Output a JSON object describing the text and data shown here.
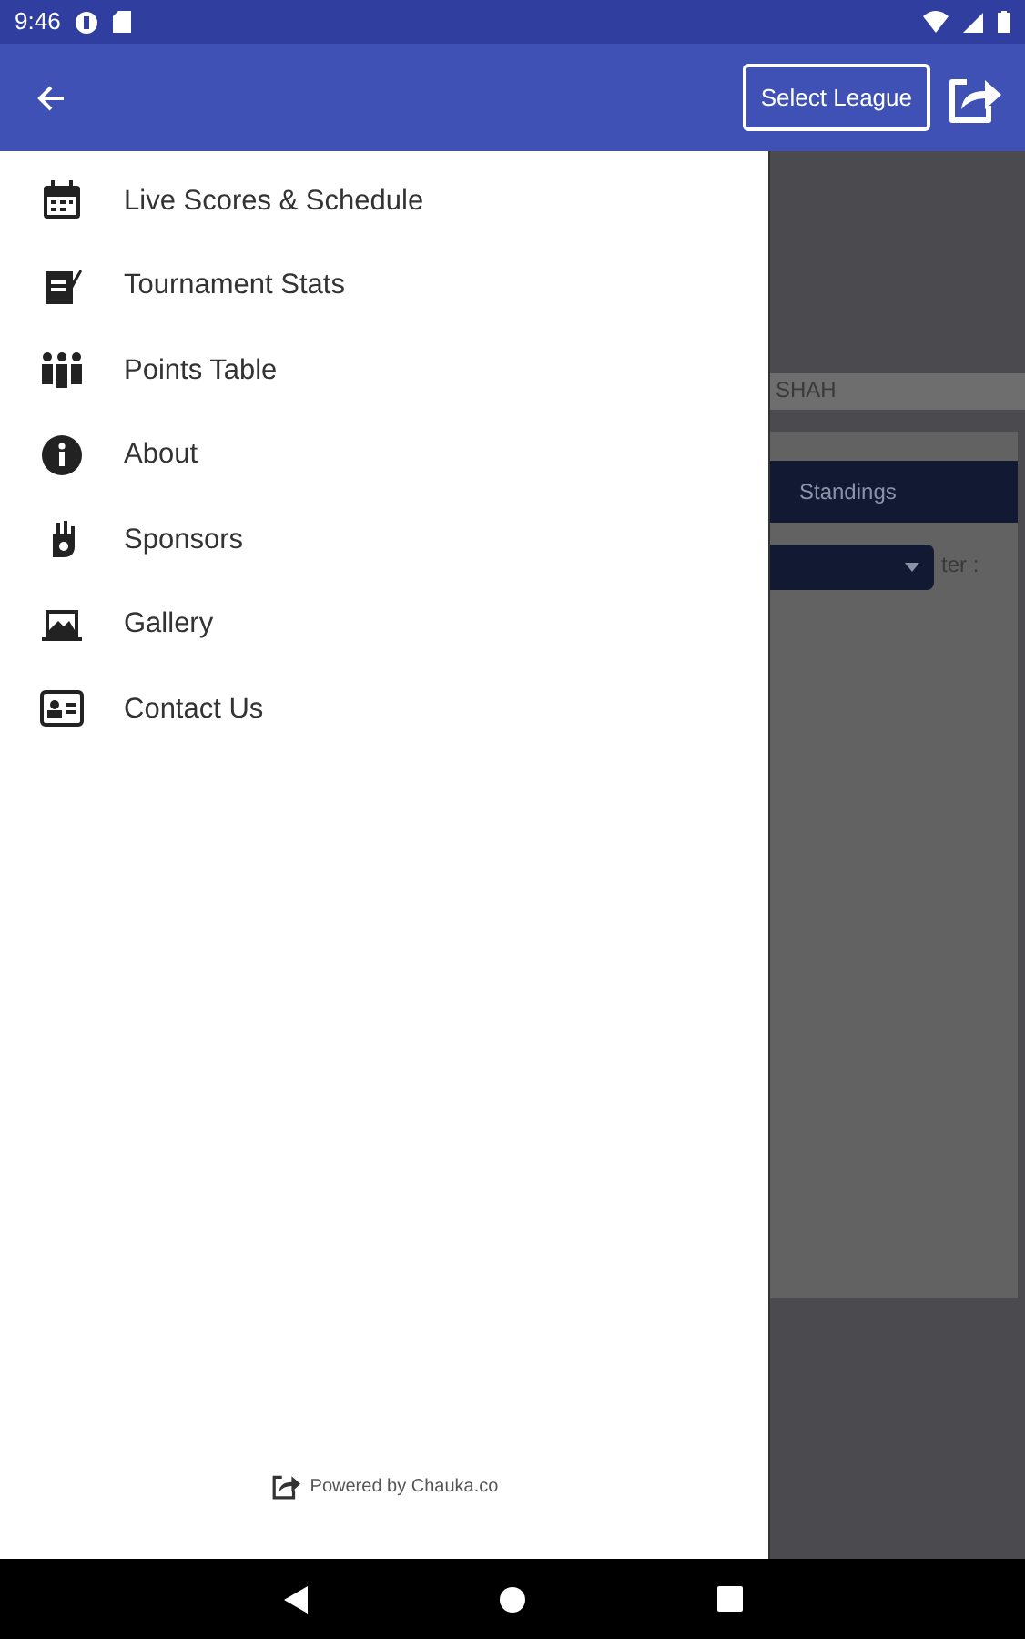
{
  "status_bar": {
    "time": "9:46"
  },
  "app_bar": {
    "select_button": "Select League"
  },
  "drawer": {
    "items": [
      {
        "label": "Live Scores & Schedule"
      },
      {
        "label": "Tournament Stats"
      },
      {
        "label": "Points Table"
      },
      {
        "label": "About"
      },
      {
        "label": "Sponsors"
      },
      {
        "label": "Gallery"
      },
      {
        "label": "Contact Us"
      }
    ],
    "footer": "Powered by Chauka.co"
  },
  "background": {
    "name_band": "SHAH",
    "tab": "Standings",
    "filter_label": "ter :"
  }
}
